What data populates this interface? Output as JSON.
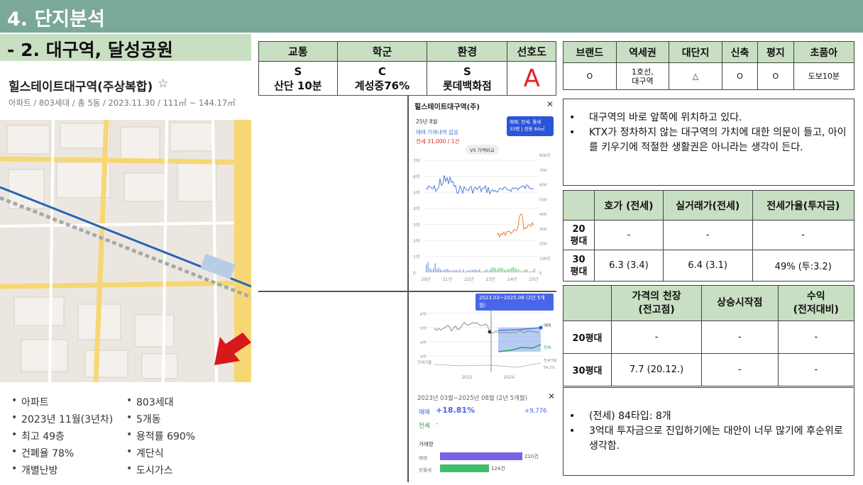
{
  "header": {
    "title": "4. 단지분석",
    "subtitle": "- 2. 대구역, 달성공원"
  },
  "apartment": {
    "name": "힐스테이트대구역(주상복합)",
    "meta": "아파트 / 803세대 / 총 5동 / 2023.11.30 / 111㎡ ~ 144.17㎡"
  },
  "features": [
    "아파트",
    "803세대",
    "2023년 11월(3년차)",
    "5개동",
    "최고 49층",
    "용적률 690%",
    "건폐율 78%",
    "계단식",
    "개별난방",
    "도시가스"
  ],
  "grade_table": {
    "headers": [
      "교통",
      "학군",
      "환경",
      "선호도"
    ],
    "grades": [
      "S",
      "C",
      "S"
    ],
    "details": [
      "산단 10분",
      "계성중76%",
      "롯데백화점"
    ],
    "preference": "A"
  },
  "brand_table": {
    "headers": [
      "브랜드",
      "역세권",
      "대단지",
      "신축",
      "평지",
      "초품아"
    ],
    "values": [
      "O",
      "1호선,",
      "△",
      "O",
      "O",
      "도보10분"
    ],
    "values_line2": [
      "",
      "대구역",
      "",
      "",
      "",
      ""
    ]
  },
  "notes_top": [
    "대구역의 바로 앞쪽에 위치하고 있다.",
    "KTX가 정차하지 않는 대구역의 가치에 대한 의문이 들고, 아이를 키우기에 적절한 생활권은 아니라는 생각이 든다."
  ],
  "price_table": {
    "headers": [
      "호가 (전세)",
      "실거래가(전세)",
      "전세가율(투자금)"
    ],
    "rows": [
      {
        "label1": "20",
        "label2": "평대",
        "values": [
          "-",
          "-",
          "-"
        ]
      },
      {
        "label1": "30",
        "label2": "평대",
        "values": [
          "6.3 (3.4)",
          "6.4 (3.1)",
          "49% (투:3.2)"
        ]
      }
    ]
  },
  "high_table": {
    "headers1": [
      "가격의 천장",
      "상승시작점",
      "수익"
    ],
    "headers2": [
      "(전고점)",
      "",
      "(전저대비)"
    ],
    "rows": [
      {
        "label": "20평대",
        "values": [
          "-",
          "-",
          "-"
        ]
      },
      {
        "label": "30평대",
        "values": [
          "7.7 (20.12.)",
          "-",
          "-"
        ]
      }
    ]
  },
  "notes_bottom": [
    "(전세) 84타입: 8개",
    "3억대 투자금으로 진입하기에는 대안이 너무 많기에 후순위로 생각함."
  ],
  "chart1": {
    "title": "힐스테이트대구역(주)",
    "date": "25년 8월",
    "sale_text": "매매 거래내역 없음",
    "jeonse_text": "전세 31,000 / 1건",
    "badge_line1": "매매, 전세, 월세",
    "badge_line2": "33평 | 전용 84㎡",
    "vs_button": "VS 가격비교",
    "y_left": [
      "7억",
      "6억",
      "5억",
      "4억",
      "3억",
      "2억",
      "1억",
      "0"
    ],
    "y_right": [
      "800건",
      "700",
      "600",
      "500",
      "400",
      "300",
      "200",
      "100건",
      "0"
    ],
    "x_labels": [
      "20년",
      "21년",
      "22년",
      "23년",
      "24년",
      "25년"
    ]
  },
  "chart2": {
    "tooltip1": "2023.03~2025.08 (2년 5개월)",
    "tooltip2": "매매 +18.81%",
    "y_labels": [
      "6억",
      "5억",
      "4억",
      "3억"
    ],
    "side_labels": [
      "매매",
      "전세",
      "전세가율",
      "54.2%"
    ],
    "bottom_label": "전세가율",
    "x_labels": [
      "2022",
      "2024"
    ]
  },
  "panel": {
    "title": "2023년 03월~2025년 08월 (2년 5개월)",
    "sale_label": "매매",
    "sale_pct": "+18.81%",
    "sale_value": "+9,776",
    "jeonse_label": "전세",
    "jeonse_pct": "-",
    "volume_label": "거래량",
    "bars": [
      {
        "label": "매매",
        "value": "210건",
        "ratio": 0.72
      },
      {
        "label": "전월세",
        "value": "124건",
        "ratio": 0.43
      }
    ]
  },
  "colors": {
    "header": "#7aa89b",
    "accent": "#c9dfc3",
    "grade_a": "#e5202a",
    "sale_line": "#4a7fd6",
    "jeonse_line": "#f07a3a",
    "arrow": "#d7191c"
  }
}
